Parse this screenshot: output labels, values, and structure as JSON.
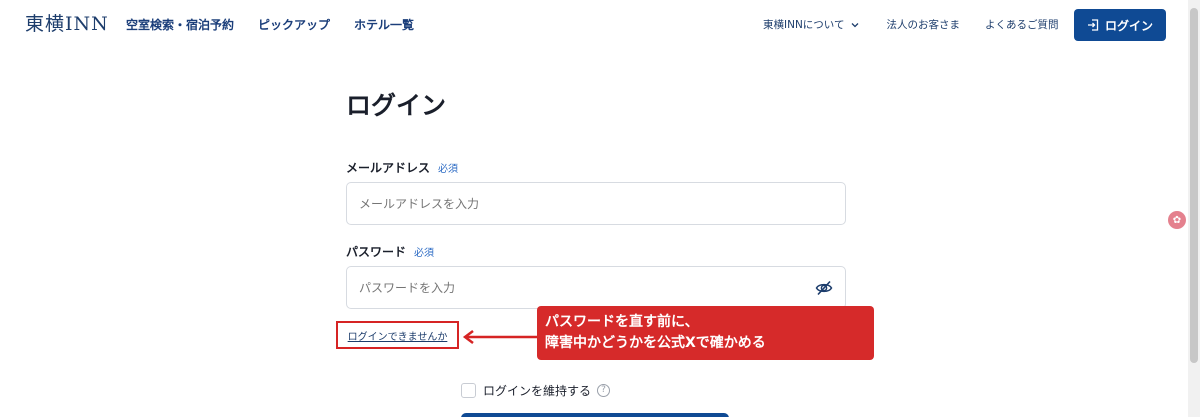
{
  "header": {
    "logo": "東横INN",
    "nav": [
      "空室検索・宿泊予約",
      "ピックアップ",
      "ホテル一覧"
    ],
    "subnav": {
      "about": "東横INNについて",
      "corporate": "法人のお客さま",
      "faq": "よくあるご質問"
    },
    "login_button": "ログイン"
  },
  "form": {
    "title": "ログイン",
    "email": {
      "label": "メールアドレス",
      "required": "必須",
      "placeholder": "メールアドレスを入力"
    },
    "password": {
      "label": "パスワード",
      "required": "必須",
      "placeholder": "パスワードを入力"
    },
    "cant_login": "ログインできませんか",
    "keep_login": "ログインを維持する"
  },
  "annotation": {
    "line1": "パスワードを直す前に、",
    "line2": "障害中かどうかを公式Xで確かめる",
    "color": "#d62a2a"
  },
  "colors": {
    "primary": "#0f4a94",
    "link": "#1b3e7a",
    "accent_red": "#d62424"
  }
}
